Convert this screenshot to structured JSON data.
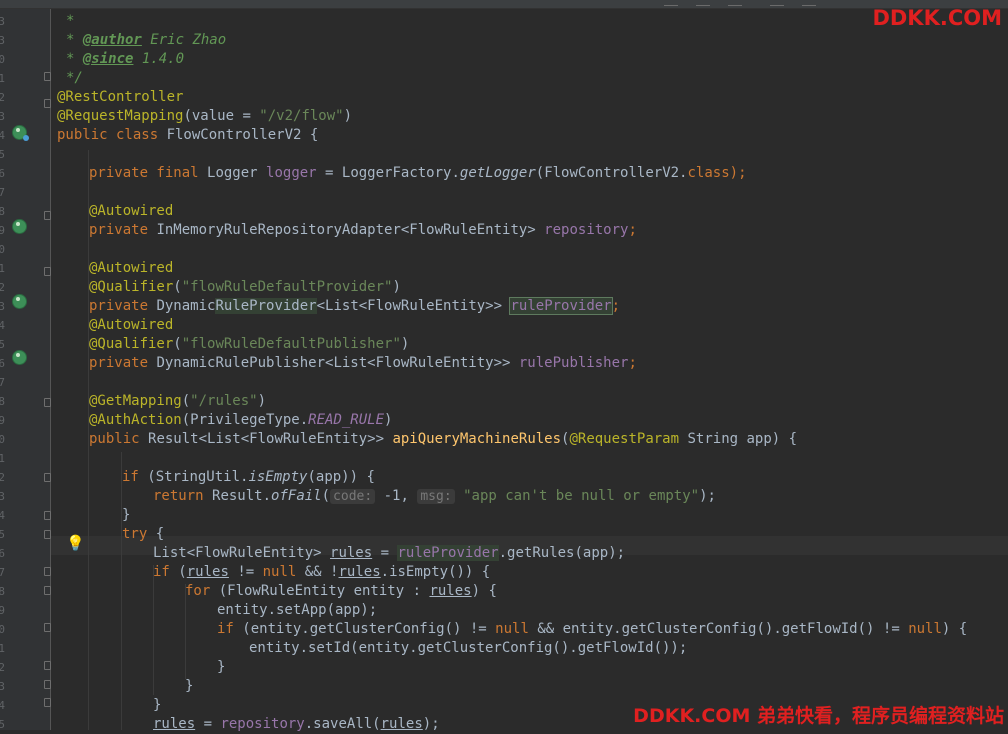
{
  "watermark_top": "DDKK.COM",
  "watermark_bottom": "DDKK.COM 弟弟快看，程序员编程资料站",
  "gutter": {
    "line_numbers": [
      "",
      "3",
      "3",
      "0",
      "1",
      "2",
      "3",
      "4",
      "5",
      "6",
      "7",
      "8",
      "9",
      "0",
      "1",
      "2",
      "3",
      "4",
      "5",
      "6",
      "7",
      "8",
      "9",
      "0",
      "1",
      "2",
      "3",
      "4",
      "5",
      "6",
      "7",
      "8",
      "9",
      "0",
      "1",
      "2",
      "3",
      "4",
      "5"
    ]
  },
  "code": {
    "l0": {
      "t1": "*"
    },
    "l1": {
      "t1": "* ",
      "tag": "@author",
      "t2": " Eric Zhao"
    },
    "l2": {
      "t1": "* ",
      "tag": "@since",
      "t2": " 1.4.0"
    },
    "l3": {
      "t1": "*/"
    },
    "l4": {
      "a": "@RestController"
    },
    "l5": {
      "a": "@RequestMapping",
      "t1": "(value = ",
      "s": "\"/v2/flow\"",
      "t2": ")"
    },
    "l6": {
      "k": "public class ",
      "t1": "FlowControllerV2 {"
    },
    "l8": {
      "k": "private final ",
      "t1": "Logger ",
      "f": "logger",
      "t2": " = LoggerFactory.",
      "st": "getLogger",
      "t3": "(FlowControllerV2.",
      "k2": "class",
      "t4": ");"
    },
    "l10": {
      "a": "@Autowired"
    },
    "l11": {
      "k": "private ",
      "t1": "InMemoryRuleRepositoryAdapter<FlowRuleEntity> ",
      "f": "repository",
      "k2": ";"
    },
    "l13": {
      "a": "@Autowired"
    },
    "l14": {
      "a": "@Qualifier",
      "t1": "(",
      "s": "\"flowRuleDefaultProvider\"",
      "t2": ")"
    },
    "l15": {
      "k": "private ",
      "t1": "Dynamic",
      "h": "RuleProvider",
      "t2": "<List<FlowRuleEntity>> ",
      "f": "ruleProvider",
      "k2": ";"
    },
    "l16": {
      "a": "@Autowired"
    },
    "l17": {
      "a": "@Qualifier",
      "t1": "(",
      "s": "\"flowRuleDefaultPublisher\"",
      "t2": ")"
    },
    "l18": {
      "k": "private ",
      "t1": "DynamicRulePublisher<List<FlowRuleEntity>> ",
      "f": "rulePublisher",
      "k2": ";"
    },
    "l20": {
      "a": "@GetMapping",
      "t1": "(",
      "s": "\"/rules\"",
      "t2": ")"
    },
    "l21": {
      "a": "@AuthAction",
      "t1": "(PrivilegeType.",
      "sf": "READ_RULE",
      "t2": ")"
    },
    "l22": {
      "k": "public ",
      "t1": "Result<List<FlowRuleEntity>> ",
      "m": "apiQueryMachineRules",
      "t2": "(",
      "a": "@RequestParam",
      "t3": " String app) {"
    },
    "l24": {
      "k": "if ",
      "t1": "(StringUtil.",
      "st": "isEmpty",
      "t2": "(app)) {"
    },
    "l25": {
      "k": "return ",
      "t1": "Result.",
      "st": "ofFail",
      "t2": "(",
      "h1": "code:",
      "t3": " -1, ",
      "h2": "msg:",
      "s": " \"app can't be null or empty\"",
      "t4": ");"
    },
    "l26": {
      "t1": "}"
    },
    "l27": {
      "k": "try ",
      "t1": "{"
    },
    "l28": {
      "t1": "List<FlowRuleEntity> ",
      "u": "rules",
      "t2": " = ",
      "f": "ruleProvider",
      "t3": ".getRules(app);"
    },
    "l29": {
      "k": "if ",
      "t1": "(",
      "u": "rules",
      "t2": " != ",
      "k2": "null",
      "t3": " && !",
      "u2": "rules",
      "t4": ".isEmpty()) {"
    },
    "l30": {
      "k": "for ",
      "t1": "(FlowRuleEntity entity : ",
      "u": "rules",
      "t2": ") {"
    },
    "l31": {
      "t1": "entity.setApp(app);"
    },
    "l32": {
      "k": "if ",
      "t1": "(entity.getClusterConfig() != ",
      "k2": "null",
      "t2": " && entity.getClusterConfig().getFlowId() != ",
      "k3": "null",
      "t3": ") {"
    },
    "l33": {
      "t1": "entity.setId(entity.getClusterConfig().getFlowId());"
    },
    "l34": {
      "t1": "}"
    },
    "l35": {
      "t1": "}"
    },
    "l36": {
      "t1": "}"
    },
    "l37": {
      "u": "rules",
      "t1": " = ",
      "f": "repository",
      "t2": ".saveAll(",
      "u2": "rules",
      "t3": ");"
    }
  }
}
